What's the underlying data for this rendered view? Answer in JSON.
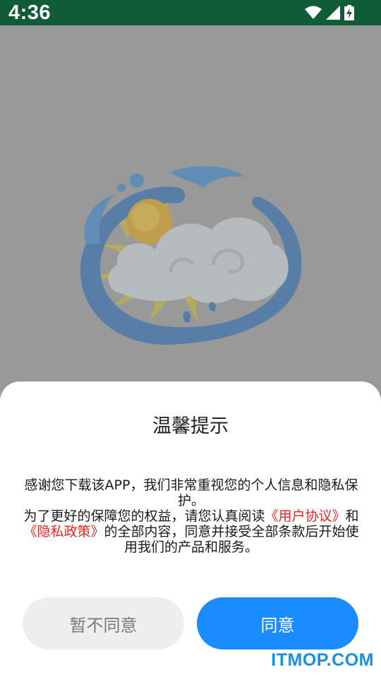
{
  "status_bar": {
    "time": "4:36",
    "icons": [
      "wifi-icon",
      "signal-icon",
      "battery-charging-icon"
    ]
  },
  "splash": {
    "logo": "sun-cloud-wave-logo"
  },
  "dialog": {
    "title": "温馨提示",
    "paragraph1": "感谢您下载该APP，我们非常重视您的个人信息和隐私保护。",
    "paragraph2_prefix": "为了更好的保障您的权益，请您认真阅读",
    "user_agreement_link": "《用户协议》",
    "and_text": "和",
    "privacy_policy_link": "《隐私政策》",
    "paragraph2_suffix": "的全部内容，同意并接受全部条款后开始使用我们的产品和服务。",
    "decline_label": "暂不同意",
    "agree_label": "同意",
    "link_color": "#e62424",
    "agree_color": "#1a8cff"
  },
  "watermark": "ITMOP.COM",
  "colors": {
    "status_bar": "#0f5c37",
    "backdrop": "#999999"
  }
}
